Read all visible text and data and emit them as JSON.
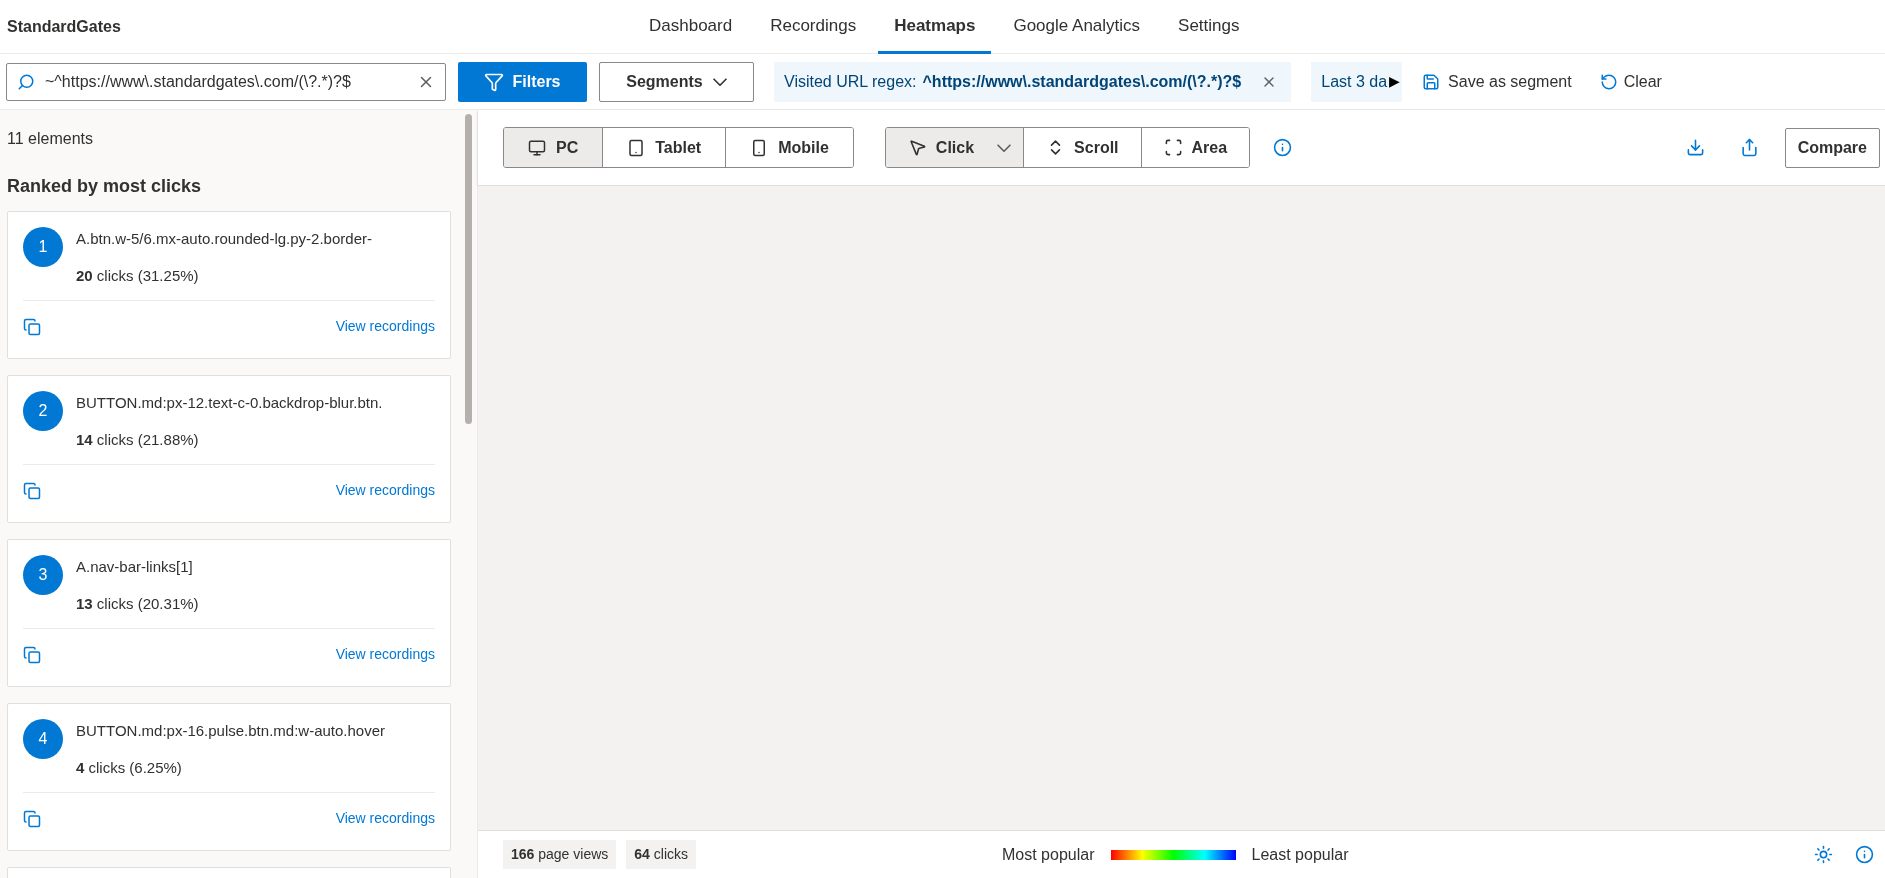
{
  "app": {
    "title": "StandardGates"
  },
  "nav": [
    {
      "label": "Dashboard",
      "selected": false
    },
    {
      "label": "Recordings",
      "selected": false
    },
    {
      "label": "Heatmaps",
      "selected": true
    },
    {
      "label": "Google Analytics",
      "selected": false
    },
    {
      "label": "Settings",
      "selected": false
    }
  ],
  "filter_bar": {
    "search": {
      "value": "~^https://www\\.standardgates\\.com/(\\?.*)?$"
    },
    "filters_button": "Filters",
    "segments_button": "Segments",
    "url_chip": {
      "label": "Visited URL regex:",
      "value": "^https://www\\.standardgates\\.com/(\\?.*)?$"
    },
    "date_chip": {
      "label": "Last 3 da",
      "arrow": "▶"
    },
    "save_button": "Save as segment",
    "clear_button": "Clear"
  },
  "sidebar": {
    "count": "11 elements",
    "heading": "Ranked by most clicks",
    "elements": [
      {
        "rank": "1",
        "selector": "A.btn.w-5/6.mx-auto.rounded-lg.py-2.border-",
        "clicks": "**20** clicks (31.25%)",
        "link": "View recordings"
      },
      {
        "rank": "2",
        "selector": "BUTTON.md:px-12.text-c-0.backdrop-blur.btn.",
        "clicks": "**14** clicks (21.88%)",
        "link": "View recordings"
      },
      {
        "rank": "3",
        "selector": "A.nav-bar-links[1]",
        "clicks": "**13** clicks (20.31%)",
        "link": "View recordings"
      },
      {
        "rank": "4",
        "selector": "BUTTON.md:px-16.pulse.btn.md:w-auto.hover",
        "clicks": "**4** clicks (6.25%)",
        "link": "View recordings"
      }
    ]
  },
  "toolbar": {
    "devices": [
      {
        "kind": "pc",
        "label": "PC",
        "selected": true
      },
      {
        "kind": "tablet",
        "label": "Tablet",
        "selected": false
      },
      {
        "kind": "mobile",
        "label": "Mobile",
        "selected": false
      }
    ],
    "modes": [
      {
        "kind": "click",
        "label": "Click",
        "selected": true,
        "dropdown": true
      },
      {
        "kind": "scroll",
        "label": "Scroll",
        "selected": false,
        "dropdown": false
      },
      {
        "kind": "area",
        "label": "Area",
        "selected": false,
        "dropdown": false
      }
    ],
    "compare_button": "Compare"
  },
  "footer": {
    "page_views": "**166** page views",
    "clicks": "**64** clicks",
    "legend_most": "Most popular",
    "legend_least": "Least popular"
  }
}
